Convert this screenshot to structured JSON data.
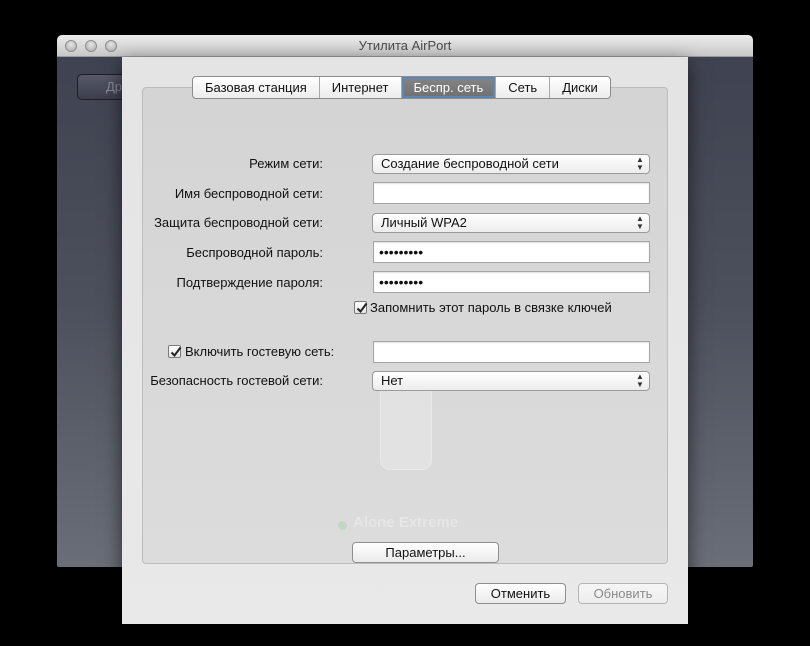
{
  "window": {
    "title": "Утилита AirPort"
  },
  "toolbar": {
    "partial_label": "Др"
  },
  "tabs": [
    {
      "label": "Базовая станция"
    },
    {
      "label": "Интернет"
    },
    {
      "label": "Беспр. сеть",
      "active": true
    },
    {
      "label": "Сеть"
    },
    {
      "label": "Диски"
    }
  ],
  "form": {
    "network_mode": {
      "label": "Режим сети:",
      "value": "Создание беспроводной сети"
    },
    "network_name": {
      "label": "Имя беспроводной сети:",
      "value": ""
    },
    "security": {
      "label": "Защита беспроводной сети:",
      "value": "Личный WPA2"
    },
    "password": {
      "label": "Беспроводной пароль:",
      "value": "•••••••••"
    },
    "confirm": {
      "label": "Подтверждение пароля:",
      "value": "•••••••••"
    },
    "remember": {
      "label": "Запомнить этот пароль в связке ключей",
      "checked": true
    },
    "guest_enable": {
      "label": "Включить гостевую сеть:",
      "checked": true,
      "value": ""
    },
    "guest_security": {
      "label": "Безопасность гостевой сети:",
      "value": "Нет"
    }
  },
  "background": {
    "device_label": "Alone Extreme"
  },
  "buttons": {
    "options": "Параметры...",
    "cancel": "Отменить",
    "update": "Обновить"
  },
  "colors": {
    "active_tab_ring": "#5f86b3",
    "active_tab_fill": "#7a7a7a"
  }
}
